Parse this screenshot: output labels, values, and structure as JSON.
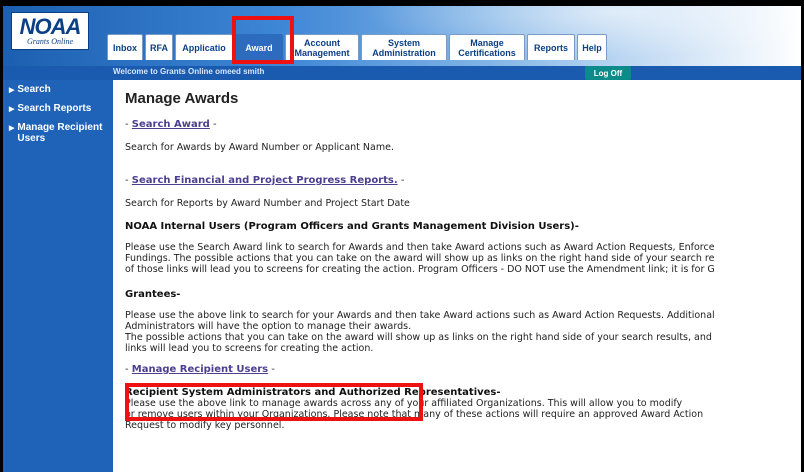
{
  "logo": {
    "mark": "NOAA",
    "sub": "Grants Online"
  },
  "tabs": [
    {
      "label": "Inbox"
    },
    {
      "label": "RFA"
    },
    {
      "label": "Applicatio"
    },
    {
      "label": "Award"
    },
    {
      "label": "Account Management"
    },
    {
      "label": "System Administration"
    },
    {
      "label": "Manage Certifications"
    },
    {
      "label": "Reports"
    },
    {
      "label": "Help"
    }
  ],
  "header": {
    "welcome": "Welcome to Grants Online omeed smith",
    "logoff": "Log Off"
  },
  "sidebar": {
    "items": [
      {
        "label": "Search"
      },
      {
        "label": "Search Reports"
      },
      {
        "label": "Manage Recipient Users"
      }
    ]
  },
  "main": {
    "title": "Manage Awards",
    "search_award_link": "Search Award",
    "search_award_desc": "Search for Awards by Award Number or Applicant Name.",
    "financial_link": "Search Financial and Project Progress Reports.",
    "financial_desc": "Search for Reports by Award Number and Project Start Date",
    "internal_heading": "NOAA Internal Users (Program Officers and Grants Management Division Users)-",
    "internal_p1": "Please use the Search Award link to search for Awards and then take Award actions such as Award Action Requests, Enforce",
    "internal_p2": "Fundings. The possible actions that you can take on the award will show up as links on the right hand side of your search re",
    "internal_p3": "of those links will lead you to screens for creating the action. Program Officers - DO NOT use the Amendment link; it is for G",
    "grantees_heading": "Grantees-",
    "grantees_p1": "Please use the above link to search for your Awards and then take Award actions such as Award Action Requests. Additional",
    "grantees_p2": "Administrators will have the option to manage their awards.",
    "grantees_p3": "The possible actions that you can take on the award will show up as links on the right hand side of your search results, and",
    "grantees_p4": "links will lead you to screens for creating the action.",
    "manage_recipient_link": "Manage Recipient Users",
    "recipient_heading": "Recipient System Administrators and Authorized Representatives-",
    "recipient_p1": "Please use the above link to manage awards across any of your affiliated Organizations. This will allow you to modify",
    "recipient_p2": "or remove users within your Organizations. Please note that many of these actions will require an approved Award Action",
    "recipient_p3": "Request to modify key personnel."
  },
  "colors": {
    "highlight": "#ee1111",
    "sidebar": "#1e63b8",
    "link": "#4b3f8f"
  }
}
